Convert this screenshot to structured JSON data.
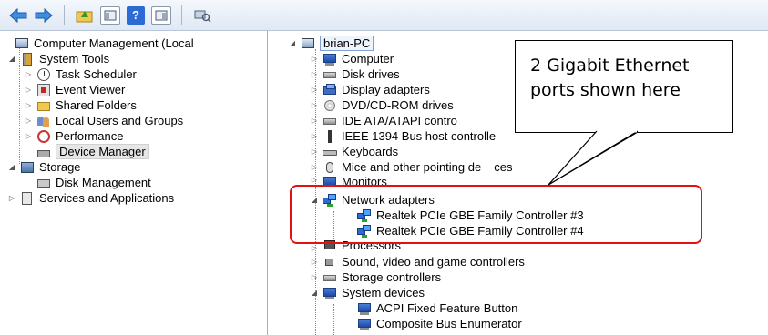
{
  "toolbar": {
    "buttons": [
      {
        "name": "back-button",
        "icon": "back-arrow-icon"
      },
      {
        "name": "forward-button",
        "icon": "forward-arrow-icon"
      },
      {
        "name": "up-folder-button",
        "icon": "folder-up-icon"
      },
      {
        "name": "show-hide-console-tree-button",
        "icon": "console-tree-icon"
      },
      {
        "name": "help-button",
        "icon": "help-icon",
        "glyph": "?"
      },
      {
        "name": "show-hide-action-pane-button",
        "icon": "action-pane-icon"
      },
      {
        "name": "scan-hardware-button",
        "icon": "scan-hardware-icon"
      }
    ]
  },
  "left_tree": {
    "root": "Computer Management (Local",
    "system_tools": "System Tools",
    "task_scheduler": "Task Scheduler",
    "event_viewer": "Event Viewer",
    "shared_folders": "Shared Folders",
    "local_users": "Local Users and Groups",
    "performance": "Performance",
    "device_manager": "Device Manager",
    "storage": "Storage",
    "disk_management": "Disk Management",
    "services_apps": "Services and Applications"
  },
  "device_tree": {
    "host": "brian-PC",
    "categories": {
      "computer": "Computer",
      "disk_drives": "Disk drives",
      "display_adapters": "Display adapters",
      "dvd": "DVD/CD-ROM drives",
      "ide": "IDE ATA/ATAPI contro",
      "ieee": "IEEE 1394 Bus host controlle",
      "keyboards": "Keyboards",
      "mice": "Mice and other pointing de",
      "mice_tail": "ces",
      "monitors": "Monitors",
      "network": "Network adapters",
      "processors": "Processors",
      "sound": "Sound, video and game controllers",
      "storage_ctrl": "Storage controllers",
      "system_devices": "System devices"
    },
    "network_children": [
      "Realtek PCIe GBE Family Controller #3",
      "Realtek PCIe GBE Family Controller #4"
    ],
    "system_children": [
      "ACPI Fixed Feature Button",
      "Composite Bus Enumerator"
    ]
  },
  "callout": {
    "line1": "2 Gigabit Ethernet",
    "line2": "ports shown here"
  },
  "colors": {
    "highlight": "#e21212",
    "toolbar_bg": "#dfe8f4",
    "selection_bg": "#e6e6e6"
  }
}
